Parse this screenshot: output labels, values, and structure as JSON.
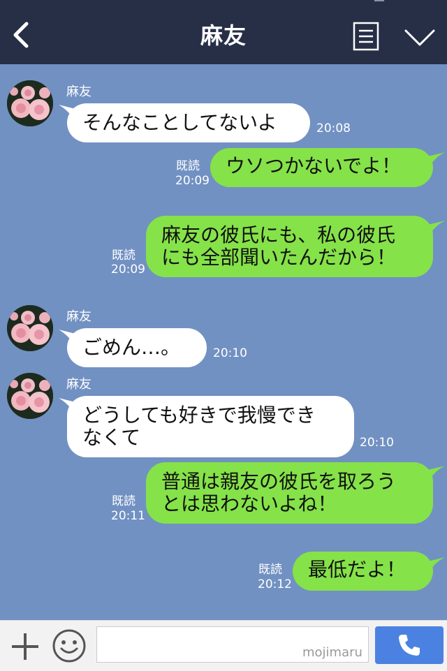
{
  "header": {
    "title": "麻友"
  },
  "messages": [
    {
      "side": "in",
      "name": "麻友",
      "lines": [
        "そんなことしてないよ"
      ],
      "time": "20:08"
    },
    {
      "side": "out",
      "read": "既読",
      "lines": [
        "ウソつかないでよ！"
      ],
      "time": "20:09"
    },
    {
      "side": "out",
      "read": "既読",
      "lines": [
        "麻友の彼氏にも、私の彼氏",
        "にも全部聞いたんだから！"
      ],
      "time": "20:09"
    },
    {
      "side": "in",
      "name": "麻友",
      "lines": [
        "ごめん…。"
      ],
      "time": "20:10"
    },
    {
      "side": "in",
      "name": "麻友",
      "lines": [
        "どうしても好きで我慢でき",
        "なくて"
      ],
      "time": "20:10"
    },
    {
      "side": "out",
      "read": "既読",
      "lines": [
        "普通は親友の彼氏を取ろう",
        "とは思わないよね！"
      ],
      "time": "20:11"
    },
    {
      "side": "out",
      "read": "既読",
      "lines": [
        "最低だよ！"
      ],
      "time": "20:12"
    }
  ],
  "input": {
    "placeholder": "",
    "watermark": "mojimaru"
  },
  "icons": {
    "back": "back-chevron-icon",
    "menu": "menu-list-icon",
    "collapse": "chevron-down-icon",
    "add": "plus-icon",
    "sticker": "smile-icon",
    "call": "phone-icon",
    "avatar": "rose-avatar"
  },
  "colors": {
    "header_bg": "#262f46",
    "chat_bg": "#7191c2",
    "incoming_bubble": "#ffffff",
    "outgoing_bubble": "#85e249",
    "call_button": "#4b82e1"
  }
}
